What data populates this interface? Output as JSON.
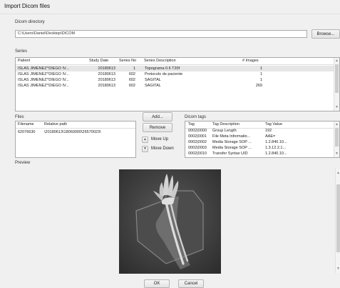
{
  "window": {
    "title": "Import Dicom files"
  },
  "dicom_directory": {
    "label": "Dicom directory",
    "path": "C:\\Users\\Daniel\\Desktop\\DICOM",
    "browse_label": "Browse..."
  },
  "series": {
    "label": "Series",
    "columns": [
      "Patient",
      "Study Date",
      "Series No",
      "Series Description",
      "# Images"
    ],
    "rows": [
      {
        "patient": "ISLAS JIMENEZ^DIEGO IV...",
        "date": "20180613",
        "no": "1",
        "desc": "Topograma 0.6 T20f",
        "images": "1"
      },
      {
        "patient": "ISLAS JIMENEZ^DIEGO IV...",
        "date": "20180613",
        "no": "602",
        "desc": "Protocolo de paciente",
        "images": "1"
      },
      {
        "patient": "ISLAS JIMENEZ^DIEGO IV...",
        "date": "20180613",
        "no": "602",
        "desc": "SAGITAL",
        "images": "1"
      },
      {
        "patient": "ISLAS JIMENEZ^DIEGO IV...",
        "date": "20180613",
        "no": "602",
        "desc": "SAGITAL",
        "images": "269"
      }
    ]
  },
  "files": {
    "label": "Files",
    "columns": [
      "Filename",
      "Relative path"
    ],
    "rows": [
      {
        "filename": "62076630",
        "path": "\\20180613\\18060000\\26570023\\"
      }
    ]
  },
  "file_buttons": {
    "add": "Add...",
    "remove": "Remove",
    "move_up": "Move Up",
    "move_down": "Move Down"
  },
  "dicom_tags": {
    "label": "Dicom tags",
    "columns": [
      "Tag",
      "Tag Description",
      "Tag Value"
    ],
    "rows": [
      {
        "tag": "0002|0000",
        "desc": "Group Length",
        "value": "192"
      },
      {
        "tag": "0002|0001",
        "desc": "File Meta Informatio...",
        "value": "AAE="
      },
      {
        "tag": "0002|0002",
        "desc": "Media Storage SOP ...",
        "value": "1.2.840.10..."
      },
      {
        "tag": "0002|0003",
        "desc": "Media Storage SOP ...",
        "value": "1.3.12.2.1..."
      },
      {
        "tag": "0002|0010",
        "desc": "Transfer Syntax UID",
        "value": "1.2.840.10..."
      }
    ]
  },
  "preview": {
    "label": "Preview"
  },
  "footer": {
    "ok": "OK",
    "cancel": "Cancel"
  }
}
